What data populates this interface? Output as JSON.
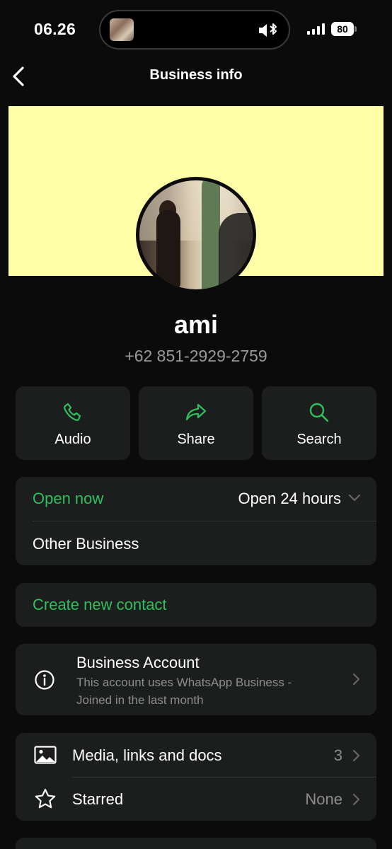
{
  "status_bar": {
    "time": "06.26",
    "battery": "80"
  },
  "header": {
    "title": "Business info"
  },
  "profile": {
    "name": "ami",
    "phone": "+62 851-2929-2759"
  },
  "actions": [
    {
      "label": "Audio",
      "icon": "phone-icon"
    },
    {
      "label": "Share",
      "icon": "share-arrow-icon"
    },
    {
      "label": "Search",
      "icon": "search-icon"
    }
  ],
  "hours": {
    "status": "Open now",
    "hours": "Open 24 hours",
    "category": "Other Business"
  },
  "create_contact": {
    "label": "Create new contact"
  },
  "business_account": {
    "title": "Business Account",
    "description_line1": "This account uses WhatsApp Business -",
    "description_line2": "Joined in the last month"
  },
  "media": {
    "label": "Media, links and docs",
    "count": "3"
  },
  "starred": {
    "label": "Starred",
    "value": "None"
  },
  "colors": {
    "accent_green": "#2fbf5c",
    "cover_yellow": "#ffffa7",
    "card_bg": "#1c1e1e"
  }
}
